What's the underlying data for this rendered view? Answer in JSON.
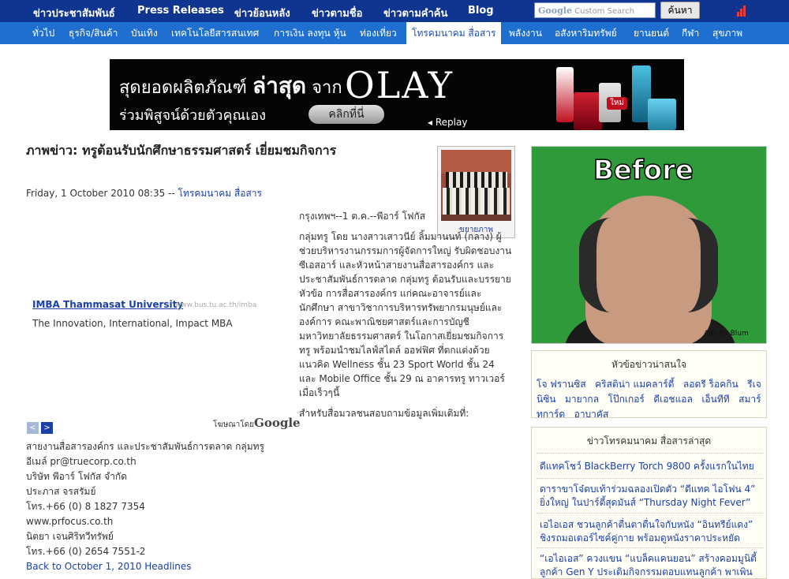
{
  "topnav": {
    "items": [
      "ข่าวประชาสัมพันธ์",
      "Press Releases",
      "ข่าวย้อนหลัง",
      "ข่าวตามชื่อ",
      "ข่าวตามคำค้น",
      "Blog"
    ],
    "search_logo": "Google",
    "search_placeholder": "Custom Search",
    "search_button": "ค้นหา"
  },
  "subnav": {
    "items": [
      "ทั่วไป",
      "ธุรกิจ/สินค้า",
      "บันเทิง",
      "เทคโนโลยีสารสนเทศ",
      "การเงิน ลงทุน หุ้น",
      "ท่องเที่ยว",
      "โทรคมนาคม สื่อสาร",
      "พลังงาน",
      "อสังหาริมทรัพย์",
      "ยานยนต์",
      "กีฬา",
      "สุขภาพ"
    ],
    "active": "โทรคมนาคม สื่อสาร"
  },
  "banner": {
    "line1_a": "สุดยอดผลิตภัณฑ์ ",
    "line1_b": "ล่าสุด",
    "line1_c": " จาก",
    "brand": "OLAY",
    "line2": "ร่วมพิสูจน์ด้วยตัวคุณเอง",
    "click": "คลิกที่นี่",
    "replay": "◂ Replay",
    "badge": "ใหม่"
  },
  "article": {
    "title": "ภาพข่าว: ทรูต้อนรับนักศึกษาธรรมศาสตร์ เยี่ยมชมกิจการ",
    "date": "Friday, 1 October 2010 08:35 -- ",
    "category": "โทรคมนาคม สื่อสาร",
    "photo_caption": "ขยายภาพ",
    "body_1": "กรุงเทพฯ--1 ต.ค.--พีอาร์ โฟกัส",
    "body_2": "กลุ่มทรู โดย นางสาวเสาวนีย์ ลิ้มมานนท์ (กลาง) ผู้ช่วยบริหารงานกรรมการผู้จัดการใหญ่ รับผิดชอบงานซีเอสอาร์ และหัวหน้าสายงานสื่อสารองค์กร และประชาสัมพันธ์การตลาด กลุ่มทรู ต้อนรับและบรรยายหัวข้อ การสื่อสารองค์กร แก่คณะอาจารย์และนักศึกษา สาขาวิชาการบริหารทรัพยากรมนุษย์และองค์การ คณะพาณิชยศาสตร์และการบัญชี มหาวิทยาลัยธรรมศาสตร์ ในโอกาสเยี่ยมชมกิจการทรู พร้อมนำชมไลฟ์สไตล์ ออฟฟิศ ที่ตกแต่งด้วยแนวคิด Wellness ชั้น 23 Sport World ชั้น 24 และ Mobile Office ชั้น 29 ณ อาคารทรู ทาวเวอร์ เมื่อเร็วๆนี้",
    "body_3": "สำหรับสื่อมวลชนสอบถามข้อมูลเพิ่มเติมที่:"
  },
  "textad": {
    "title": "IMBA Thammasat University",
    "url": "www.bus.tu.ac.th/imba",
    "desc": "The Innovation, International, Impact MBA",
    "prev": "<",
    "next": ">",
    "adsby": "โฆษณาโดย",
    "adsby_brand": "Google"
  },
  "contact": {
    "lines": [
      "สายงานสื่อสารองค์กร และประชาสัมพันธ์การตลาด กลุ่มทรู",
      "อีเมล์ pr@truecorp.co.th",
      "บริษัท พีอาร์ โฟกัส จำกัด",
      "ประภาส จรสรัมย์",
      "โทร.+66 (0) 8 1827 7354",
      "www.prfocus.co.th",
      "นิตยา เจนศิริทวีทรัพย์",
      "โทร.+66 (0) 2654 7551-2"
    ],
    "back_link": "Back to October 1, 2010 Headlines"
  },
  "side_ad": {
    "headline": "Before",
    "mark": "Ads By Blum"
  },
  "interesting": {
    "title": "หัวข้อข่าวน่าสนใจ",
    "links": [
      "โจ ฟรานซิส",
      "คริสติน่า แมคลาร์ตี้",
      "ลอดรี ร็อคกิน",
      "รีเจนิซิน",
      "มายากล",
      "โป๊กเกอร์",
      "ดีเอชแอล",
      "เอ็นทีที",
      "สมาร์ทการ์ด",
      "อาบาคัส"
    ]
  },
  "latest": {
    "title": "ข่าวโทรคมนาคม สื่อสารล่าสุด",
    "items": [
      "ดีแทคโชว์ BlackBerry Torch 9800 ครั้งแรกในไทย",
      "ดาราขาโจ๋ตบเท้าร่วมฉลองเปิดตัว “ดีแทค ไอโฟน 4” ยิ่งใหญ่ ในปาร์ตี้สุดมันส์ “Thursday Night Fever”",
      "เอไอเอส ชวนลูกค้าตื่นตาตื่นใจกับหนัง “อินทรีย์แดง” ชิงรถมอเตอร์ไซค์คู่กาย พร้อมดูหนังราคาประหยัด",
      "“เอไอเอส” ควงแขน “แบล็คแคนยอน” สร้างคอมมูนิตี้ลูกค้า Gen Y ประเดิมกิจกรรมตอบแทนลูกค้า พาเพิน"
    ]
  },
  "colors": {
    "topnav": "#0f3590",
    "subnav": "#1e6fd0",
    "link": "#1a3fa8",
    "box_bg": "#fffef6"
  }
}
